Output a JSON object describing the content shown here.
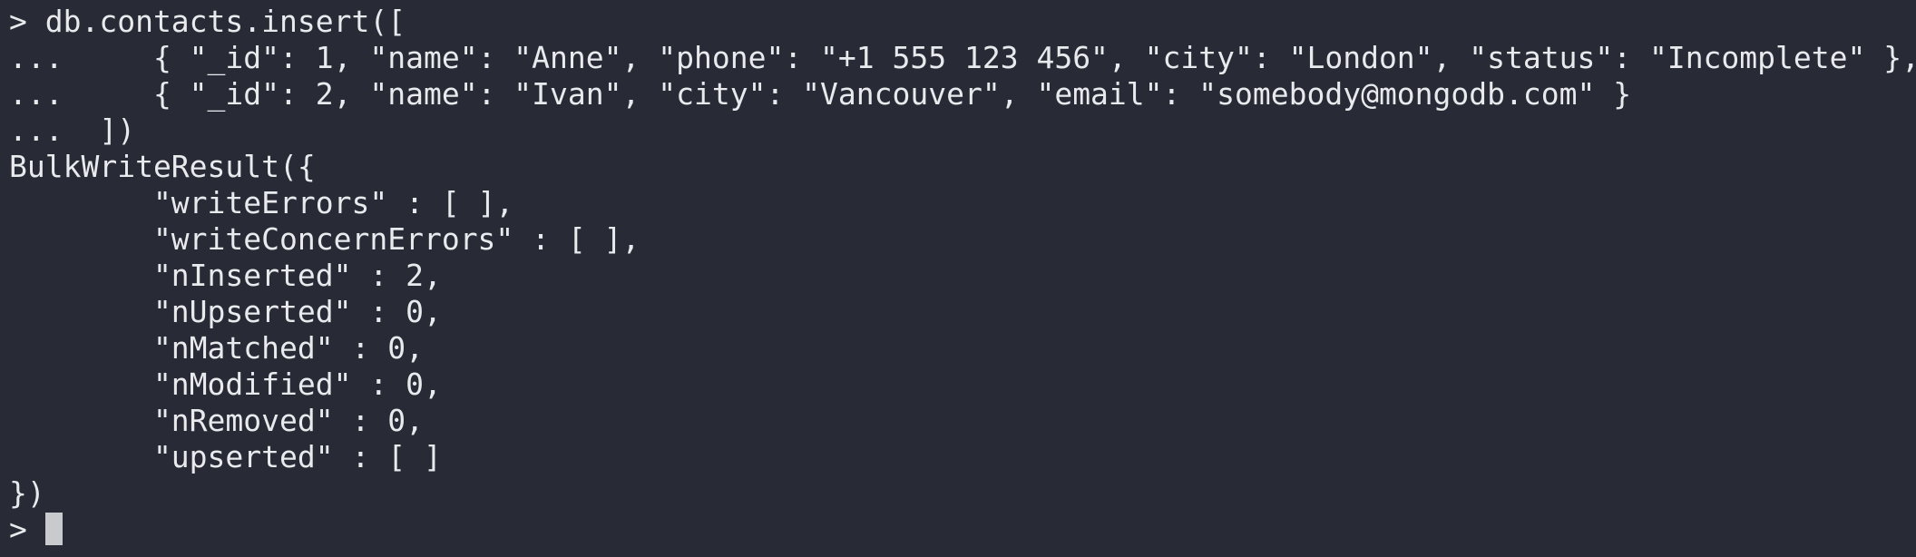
{
  "terminal": {
    "lines": [
      "> db.contacts.insert([",
      "...     { \"_id\": 1, \"name\": \"Anne\", \"phone\": \"+1 555 123 456\", \"city\": \"London\", \"status\": \"Incomplete\" },",
      "...     { \"_id\": 2, \"name\": \"Ivan\", \"city\": \"Vancouver\", \"email\": \"somebody@mongodb.com\" }",
      "...  ])",
      "BulkWriteResult({",
      "        \"writeErrors\" : [ ],",
      "        \"writeConcernErrors\" : [ ],",
      "        \"nInserted\" : 2,",
      "        \"nUpserted\" : 0,",
      "        \"nMatched\" : 0,",
      "        \"nModified\" : 0,",
      "        \"nRemoved\" : 0,",
      "        \"upserted\" : [ ]",
      "})"
    ],
    "prompt": "> "
  }
}
